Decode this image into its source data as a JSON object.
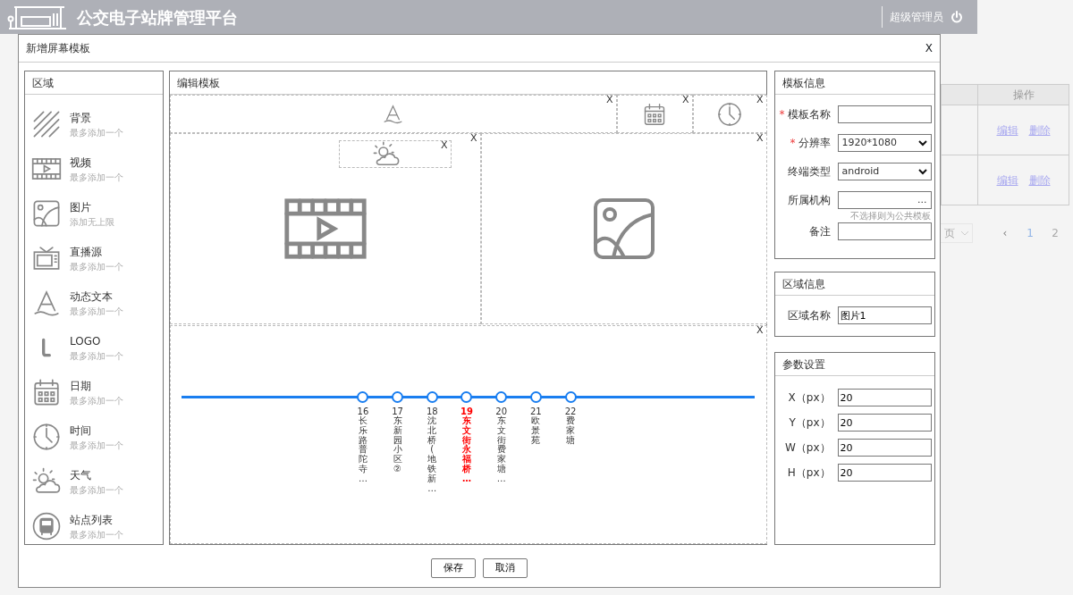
{
  "header": {
    "title": "公交电子站牌管理平台",
    "user": "超级管理员"
  },
  "background_table": {
    "columns": [
      "操作"
    ],
    "rows": [
      {
        "actions": [
          "编辑",
          "删除"
        ]
      },
      {
        "actions": [
          "编辑",
          "删除"
        ]
      }
    ]
  },
  "background_pagination": {
    "page_size": "页",
    "prev": "‹",
    "pages": [
      {
        "label": "1",
        "selected": true
      },
      {
        "label": "2",
        "selected": false
      }
    ]
  },
  "dialog": {
    "title": "新增屏幕模板",
    "close": "X",
    "palette": {
      "title": "区域",
      "items": [
        {
          "kind": "background",
          "name": "背景",
          "hint": "最多添加一个"
        },
        {
          "kind": "video",
          "name": "视频",
          "hint": "最多添加一个"
        },
        {
          "kind": "image",
          "name": "图片",
          "hint": "添加无上限"
        },
        {
          "kind": "live",
          "name": "直播源",
          "hint": "最多添加一个"
        },
        {
          "kind": "text",
          "name": "动态文本",
          "hint": "最多添加一个"
        },
        {
          "kind": "logo",
          "name": "LOGO",
          "hint": "最多添加一个"
        },
        {
          "kind": "date",
          "name": "日期",
          "hint": "最多添加一个"
        },
        {
          "kind": "time",
          "name": "时间",
          "hint": "最多添加一个"
        },
        {
          "kind": "weather",
          "name": "天气",
          "hint": "最多添加一个"
        },
        {
          "kind": "stations",
          "name": "站点列表",
          "hint": "最多添加一个"
        }
      ]
    },
    "editor": {
      "title": "编辑模板",
      "regions": [
        {
          "kind": "text",
          "close": "X"
        },
        {
          "kind": "date",
          "close": "X"
        },
        {
          "kind": "time",
          "close": "X"
        },
        {
          "kind": "video",
          "close": "X"
        },
        {
          "kind": "image",
          "close": "X"
        },
        {
          "kind": "weather",
          "close": "X"
        },
        {
          "kind": "stations",
          "close": "X",
          "stations": [
            {
              "number": "16",
              "name": "长乐路普陀寺…",
              "selected": false
            },
            {
              "number": "17",
              "name": "东新园小区②",
              "selected": false
            },
            {
              "number": "18",
              "name": "沈北桥(地铁新…",
              "selected": false
            },
            {
              "number": "19",
              "name": "东文街永福桥…",
              "selected": true
            },
            {
              "number": "20",
              "name": "东文街费家塘…",
              "selected": false
            },
            {
              "number": "21",
              "name": "欧景苑",
              "selected": false
            },
            {
              "number": "22",
              "name": "费家塘",
              "selected": false
            }
          ]
        }
      ]
    },
    "template_info": {
      "title": "模板信息",
      "fields": [
        {
          "label": "模板名称",
          "required_mark": "*",
          "kind": "text"
        },
        {
          "label": "分辨率",
          "required_mark": "*",
          "kind": "select",
          "value": "1920*1080"
        },
        {
          "label": "终端类型",
          "kind": "select",
          "value": "android"
        },
        {
          "label": "所属机构",
          "kind": "picker",
          "button": "...",
          "hint": "不选择则为公共模板"
        },
        {
          "label": "备注",
          "kind": "text"
        }
      ]
    },
    "region_info": {
      "title": "区域信息",
      "fields": [
        {
          "label": "区域名称",
          "kind": "text",
          "value": "图片1"
        }
      ]
    },
    "params": {
      "title": "参数设置",
      "fields": [
        {
          "label": "X（px）",
          "kind": "text",
          "value": "20"
        },
        {
          "label": "Y（px）",
          "kind": "text",
          "value": "20"
        },
        {
          "label": "W（px）",
          "kind": "text",
          "value": "20"
        },
        {
          "label": "H（px）",
          "kind": "text",
          "value": "20"
        }
      ]
    },
    "buttons": [
      "保存",
      "取消"
    ]
  }
}
